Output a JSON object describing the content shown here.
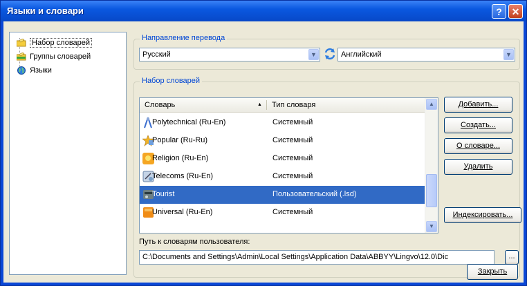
{
  "window": {
    "title": "Языки и словари",
    "help_glyph": "?",
    "close_glyph": "✕"
  },
  "tree": {
    "items": [
      {
        "label": "Набор словарей",
        "icon": "folder-pencil-yellow-icon",
        "selected": true
      },
      {
        "label": "Группы словарей",
        "icon": "folder-pencil-green-icon",
        "selected": false
      },
      {
        "label": "Языки",
        "icon": "globe-icon",
        "selected": false
      }
    ]
  },
  "direction": {
    "title": "Направление перевода",
    "source": "Русский",
    "target": "Английский",
    "swap_icon": "swap-arrows-icon"
  },
  "dict_set": {
    "title": "Набор словарей",
    "columns": [
      "Словарь",
      "Тип словаря"
    ],
    "sort_glyph": "▲",
    "rows": [
      {
        "name": "Polytechnical (Ru-En)",
        "type": "Системный",
        "icon": "compass-icon",
        "color": "#3d6fcf"
      },
      {
        "name": "Popular (Ru-Ru)",
        "type": "Системный",
        "icon": "star-icon",
        "color": "#e8a21c"
      },
      {
        "name": "Religion (Ru-En)",
        "type": "Системный",
        "icon": "sun-icon",
        "color": "#f2b91b"
      },
      {
        "name": "Telecoms (Ru-En)",
        "type": "Системный",
        "icon": "satellite-icon",
        "color": "#7aa0c8"
      },
      {
        "name": "Tourist",
        "type": "Пользовательский (.lsd)",
        "icon": "tourist-icon",
        "color": "#556b6f",
        "selected": true
      },
      {
        "name": "Universal (Ru-En)",
        "type": "Системный",
        "icon": "book-icon",
        "color": "#e07a10"
      }
    ]
  },
  "buttons": {
    "add": "Добавить...",
    "create": "Создать...",
    "about": "О словаре...",
    "delete": "Удалить",
    "index": "Индексировать...",
    "close": "Закрыть",
    "browse": "..."
  },
  "path": {
    "label": "Путь к словарям пользователя:",
    "value": "C:\\Documents and Settings\\Admin\\Local Settings\\Application Data\\ABBYY\\Lingvo\\12.0\\Dic"
  }
}
